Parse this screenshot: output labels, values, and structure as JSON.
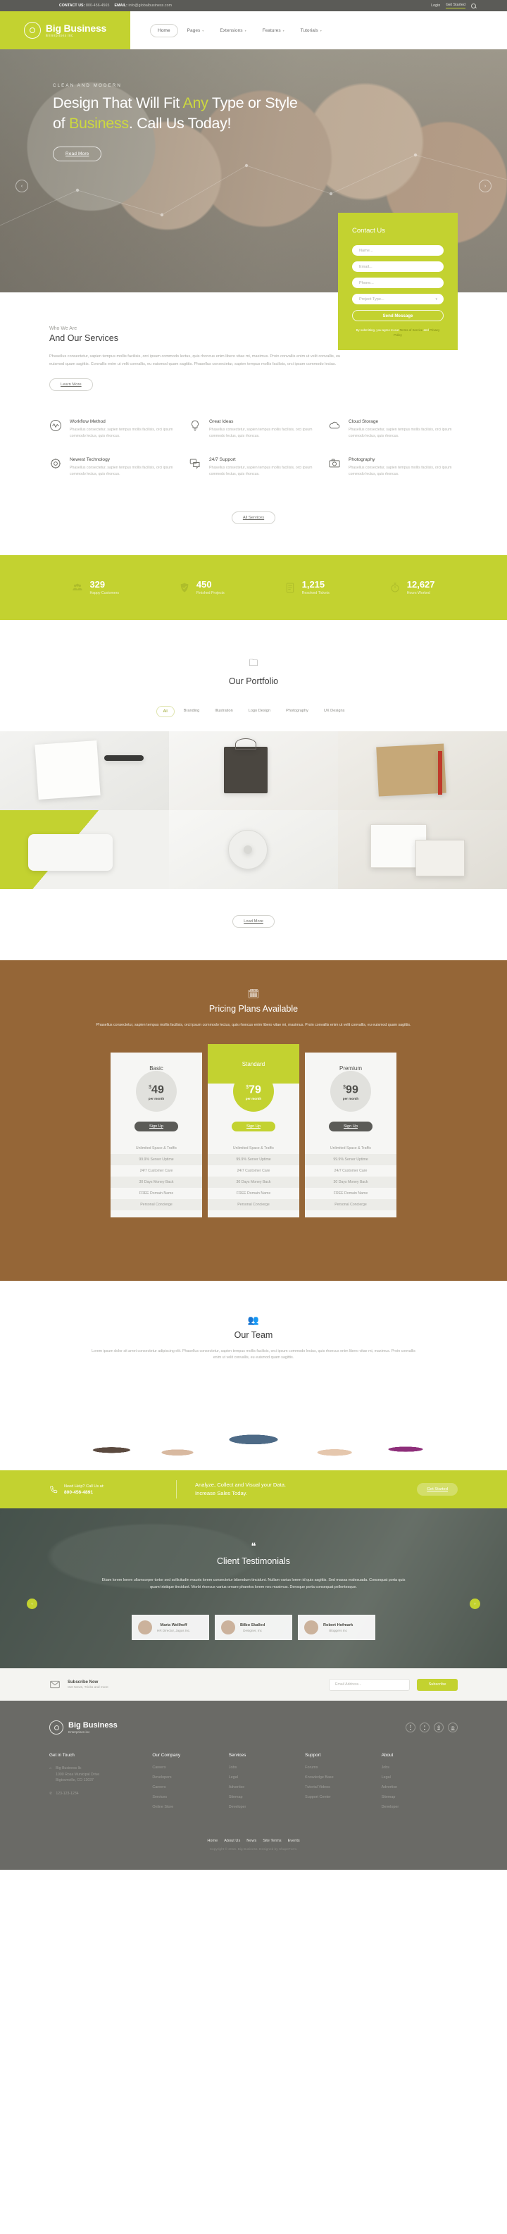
{
  "topbar": {
    "contact_label": "CONTACT US:",
    "phone": "800-456-4565",
    "email_label": "EMAIL:",
    "email": "info@globalbusiness.com",
    "login": "Login",
    "get_started": "Get Started",
    "search_icon": "search-icon"
  },
  "brand": {
    "name": "Big Business",
    "tagline": "Enterprises inc"
  },
  "nav": [
    {
      "label": "Home",
      "active": true,
      "caret": false
    },
    {
      "label": "Pages",
      "active": false,
      "caret": true
    },
    {
      "label": "Extensions",
      "active": false,
      "caret": true
    },
    {
      "label": "Features",
      "active": false,
      "caret": true
    },
    {
      "label": "Tutorials",
      "active": false,
      "caret": true
    }
  ],
  "hero": {
    "eyebrow": "CLEAN AND MODERN",
    "line1_a": "Design That Will Fit ",
    "line1_hl": "Any",
    "line1_b": " Type or Style",
    "line2_a": "of ",
    "line2_hl": "Business",
    "line2_b": ". Call Us Today!",
    "button": "Read More",
    "prev": "‹",
    "next": "›"
  },
  "contact_form": {
    "title": "Contact Us",
    "name_placeholder": "Name...",
    "email_placeholder": "Email...",
    "phone_placeholder": "Phone...",
    "project_placeholder": "Project Type...",
    "submit": "Send Message",
    "terms_pre": "By submitting, you agree to our ",
    "terms_link1": "Terms of Service",
    "terms_mid": " and ",
    "terms_link2": "Privacy Policy"
  },
  "about": {
    "kicker": "Who We Are",
    "title": "And Our Services",
    "body": "Phasellus consectetur, sapien tempus mollis facilisis, orci ipsum commodo lectus, quis rhoncus enim libero vitae mi, maximus. Proin convallis enim ut velit convallis, eu euismod quam sagittis. Convallis enim ut velit convallis, eu euismod quam sagittis. Phasellus consectetur, sapien tempus mollis facilisis, orci ipsum commodo lectus.",
    "button": "Learn More",
    "all_services": "All Services"
  },
  "services": [
    {
      "icon": "pulse-wave-icon",
      "title": "Workflow Method",
      "desc": "Phasellus consectetur, sapien tempus mollis facilisis, orci ipsum commodo lectus, quis rhoncus."
    },
    {
      "icon": "lightbulb-icon",
      "title": "Great Ideas",
      "desc": "Phasellus consectetur, sapien tempus mollis facilisis, orci ipsum commodo lectus, quis rhoncus."
    },
    {
      "icon": "cloud-icon",
      "title": "Cloud Storage",
      "desc": "Phasellus consectetur, sapien tempus mollis facilisis, orci ipsum commodo lectus, quis rhoncus."
    },
    {
      "icon": "gear-icon",
      "title": "Newest Technology",
      "desc": "Phasellus consectetur, sapien tempus mollis facilisis, orci ipsum commodo lectus, quis rhoncus."
    },
    {
      "icon": "chat-bubbles-icon",
      "title": "24/7 Support",
      "desc": "Phasellus consectetur, sapien tempus mollis facilisis, orci ipsum commodo lectus, quis rhoncus."
    },
    {
      "icon": "camera-icon",
      "title": "Photography",
      "desc": "Phasellus consectetur, sapien tempus mollis facilisis, orci ipsum commodo lectus, quis rhoncus."
    }
  ],
  "stats": [
    {
      "icon": "people-icon",
      "number": "329",
      "label": "Happy Customers"
    },
    {
      "icon": "check-badge-icon",
      "number": "450",
      "label": "Finished Projects"
    },
    {
      "icon": "clipboard-icon",
      "number": "1,215",
      "label": "Resolved Tickets"
    },
    {
      "icon": "stopwatch-icon",
      "number": "12,627",
      "label": "Hours Worked"
    }
  ],
  "portfolio": {
    "icon": "folder-icon",
    "title": "Our Portfolio",
    "filters": [
      {
        "label": "All",
        "active": true
      },
      {
        "label": "Branding",
        "active": false
      },
      {
        "label": "Illustration",
        "active": false
      },
      {
        "label": "Logo Design",
        "active": false
      },
      {
        "label": "Photography",
        "active": false
      },
      {
        "label": "UX Designs",
        "active": false
      }
    ],
    "load_more": "Load More"
  },
  "pricing": {
    "icon": "calendar-icon",
    "title": "Pricing Plans Available",
    "subtitle": "Phasellus consectetur, sapien tempus mollis facilisis, orci ipsum commodo lectus, quis rhoncus enim libero vitae mi, maximus. Proin convallis enim ut velit convallis, eu euismod quam sagittis.",
    "features": [
      "Unlimited Space & Traffic",
      "99.9% Server Uptime",
      "24/7 Customer Care",
      "30 Days Money Back",
      "FREE Domain Name",
      "Personal Concierge"
    ],
    "plans": [
      {
        "name": "Basic",
        "currency": "$",
        "price": "49",
        "period": "per month",
        "cta": "Sign Up",
        "featured": false
      },
      {
        "name": "Standard",
        "currency": "$",
        "price": "79",
        "period": "per month",
        "cta": "Sign Up",
        "featured": true
      },
      {
        "name": "Premium",
        "currency": "$",
        "price": "99",
        "period": "per month",
        "cta": "Sign Up",
        "featured": false
      }
    ]
  },
  "team": {
    "icon": "people-group-icon",
    "title": "Our Team",
    "body": "Lorem ipsum dolor sit amet consectetur adipiscing elit. Phasellus consectetur, sapien tempus mollis facilisis, orci ipsum commodo lectus, quis rhoncus enim libero vitae mi, maximus. Proin convallis enim ut velit convallis, eu euismod quam sagittis."
  },
  "cta": {
    "phone_icon": "phone-icon",
    "help_label": "Need Help? Call Us at:",
    "phone": "800-456-4891",
    "line1": "Analyze, Collect and Visual your Data.",
    "line2": "Increase Sales Today.",
    "button": "Get Started"
  },
  "testimonials": {
    "icon": "quote-icon",
    "title": "Client Testimonials",
    "quote": "Etiam lorem lorem ullamcorper tortor sed sollicitudin mauris lorem consectetur bibendum tincidunt. Nullam varius lorem id quis sagittis. Sed massa malesuada. Consequat porta quis quam tristique tincidunt. Morbi rhoncus varius ornare pharetra lorem nec maximus. Densque porta consequat pellentesque.",
    "prev": "‹",
    "next": "›",
    "cards": [
      {
        "name": "Maria Wellhoff",
        "role": "HR Director, Jagus Inc."
      },
      {
        "name": "Bilbo Skalled",
        "role": "Designer, Inc"
      },
      {
        "name": "Robert Hofmark",
        "role": "Bloggers Inc"
      }
    ]
  },
  "newsletter": {
    "icon": "envelope-icon",
    "title": "Subscribe Now",
    "subtitle": "Get News, Tricks and more",
    "placeholder": "Email Address...",
    "button": "Subscribe"
  },
  "footer": {
    "brand": "Big Business",
    "tagline": "Enterprises inc",
    "socials": [
      {
        "name": "facebook-icon",
        "glyph": "f"
      },
      {
        "name": "twitter-icon",
        "glyph": "ᵛ"
      },
      {
        "name": "google-plus-icon",
        "glyph": "g"
      },
      {
        "name": "rss-icon",
        "glyph": "◎"
      }
    ],
    "get_in_touch": {
      "title": "Get in Touch",
      "address_icon": "home-icon",
      "address_line1": "Big Business llc",
      "address_line2": "1000 Rosa Municipal Drive",
      "address_line3": "Bigtownville, CO 13037",
      "phone_icon": "phone-icon",
      "phone": "123-123-1234"
    },
    "columns": [
      {
        "title": "Our Company",
        "links": [
          "Careers",
          "Developers",
          "Careers",
          "Services",
          "Online Store"
        ]
      },
      {
        "title": "Services",
        "links": [
          "Jobs",
          "Legal",
          "Advertise",
          "Sitemap",
          "Developer"
        ]
      },
      {
        "title": "Support",
        "links": [
          "Forums",
          "Knowledge Base",
          "Tutorial Videos",
          "Support Center"
        ]
      },
      {
        "title": "About",
        "links": [
          "Jobs",
          "Legal",
          "Advertise",
          "Sitemap",
          "Developer"
        ]
      }
    ],
    "bottom_links": [
      "Home",
      "About Us",
      "News",
      "Site Terms",
      "Events"
    ],
    "copyright": "Copyright © 2016. Big Business. Designed by ShapeForm."
  },
  "colors": {
    "accent": "#c3d230",
    "dark": "#5b5b57",
    "footer": "#6a6a66"
  }
}
